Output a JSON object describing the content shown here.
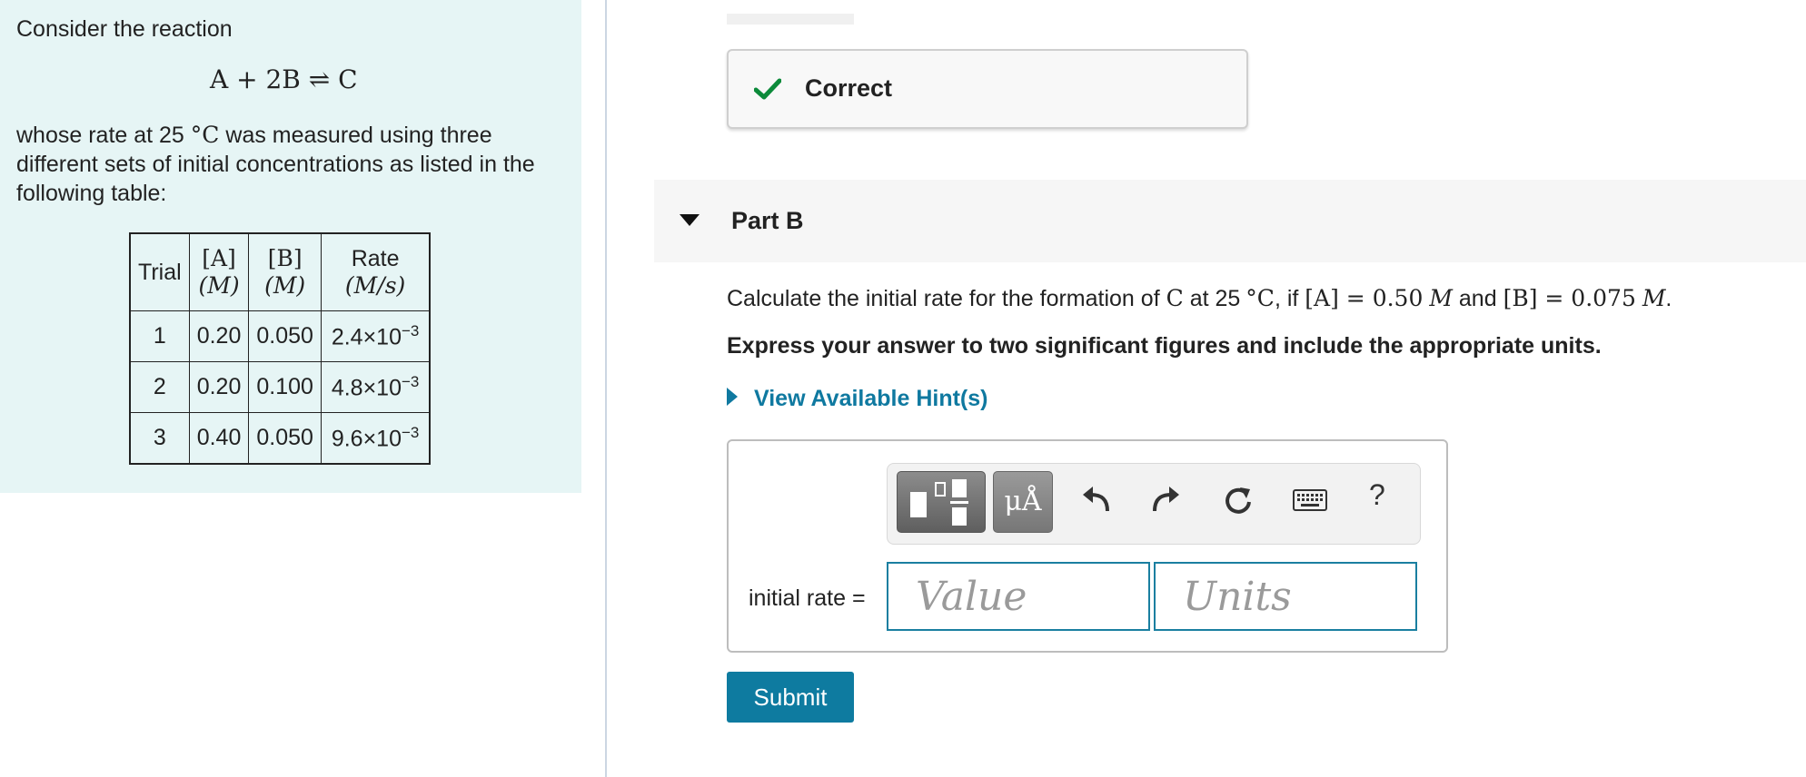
{
  "problem": {
    "intro": "Consider the reaction",
    "equation": {
      "lhs": "A + 2B",
      "arrow": "⇌",
      "rhs": "C"
    },
    "desc_before": "whose rate at 25",
    "desc_unit": "°C",
    "desc_after": "was measured using three different sets of initial concentrations as listed in the following table:",
    "table": {
      "headers": {
        "trial": "Trial",
        "a_top": "[A]",
        "a_bot": "(M)",
        "b_top": "[B]",
        "b_bot": "(M)",
        "rate_top": "Rate",
        "rate_bot": "(M/s)"
      },
      "rows": [
        {
          "trial": "1",
          "a": "0.20",
          "b": "0.050",
          "rate_mant": "2.4×10",
          "rate_exp": "−3"
        },
        {
          "trial": "2",
          "a": "0.20",
          "b": "0.100",
          "rate_mant": "4.8×10",
          "rate_exp": "−3"
        },
        {
          "trial": "3",
          "a": "0.40",
          "b": "0.050",
          "rate_mant": "9.6×10",
          "rate_exp": "−3"
        }
      ]
    }
  },
  "feedback": {
    "label": "Correct",
    "icon": "checkmark-icon",
    "color": "#0c8a3a"
  },
  "part": {
    "title": "Part B",
    "icon": "caret-down-icon"
  },
  "question": {
    "p1": "Calculate the initial rate for the formation of",
    "species": "C",
    "p2": "at 25",
    "unit": "°C",
    "p3": ", if",
    "a_term": "[A] = 0.50",
    "m1": "M",
    "p4": "and",
    "b_term": "[B] = 0.075",
    "m2": "M",
    "end": "."
  },
  "instruction": "Express your answer to two significant figures and include the appropriate units.",
  "hint": {
    "label": "View Available Hint(s)",
    "icon": "caret-right-icon"
  },
  "answer": {
    "label": "initial rate =",
    "value_placeholder": "Value",
    "units_placeholder": "Units",
    "toolbar": {
      "templates_icon": "templates-icon",
      "units_symbol": "μÅ",
      "undo_icon": "undo-icon",
      "redo_icon": "redo-icon",
      "reset_icon": "reset-icon",
      "keyboard_icon": "keyboard-icon",
      "help_label": "?"
    }
  },
  "submit_label": "Submit",
  "colors": {
    "accent": "#0e7ba0",
    "left_pane_bg": "#e6f5f5",
    "correct_green": "#0c8a3a"
  }
}
